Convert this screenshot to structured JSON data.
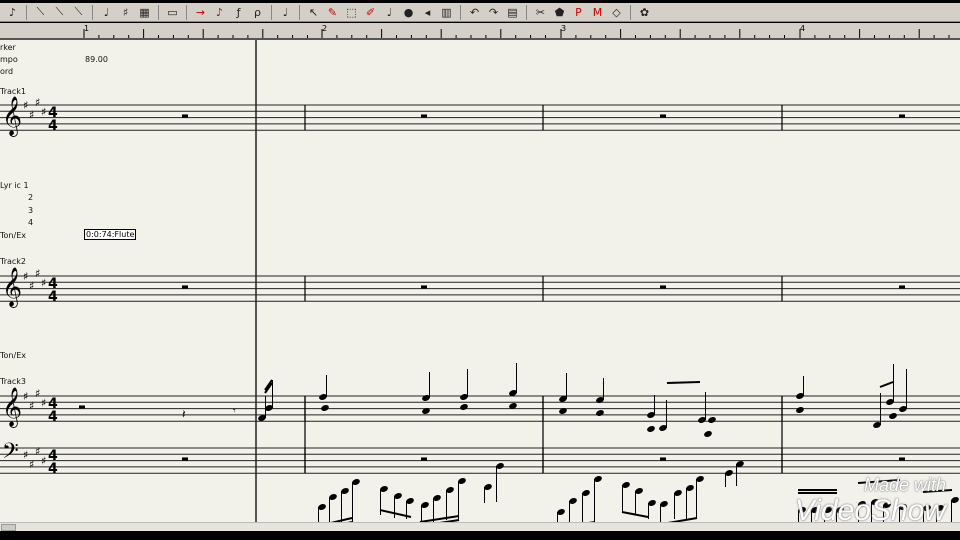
{
  "toolbar": {
    "icons": [
      "note-icon",
      "slur-icon",
      "slur-icon-2",
      "slur-icon-3",
      "quarter-notes-icon",
      "transpose-icon",
      "grid-icon",
      "keyboard-icon",
      "arrow-right-icon",
      "play-step-icon",
      "forte-icon",
      "piano-icon",
      "note-box-icon",
      "select-arrow-icon",
      "pencil-icon",
      "select-region-icon",
      "eraser-pen-icon",
      "note-select-icon",
      "color-select-icon",
      "volume-select-icon",
      "piano-select-icon",
      "undo-icon",
      "redo-icon",
      "save-icon",
      "cut-icon",
      "paste-icon",
      "page-down-icon",
      "measure-down-icon",
      "eraser-icon",
      "palette-icon"
    ]
  },
  "ruler": {
    "measures": [
      "1",
      "2",
      "3",
      "4"
    ]
  },
  "labels": {
    "marker": "rker",
    "tempo": "mpo",
    "tempo_value": "89.00",
    "chord": "ord",
    "track1": "Track1",
    "lyric": "Lyr ic  1",
    "lyric2": "2",
    "lyric3": "3",
    "lyric4": "4",
    "tonex1": "Ton/Ex",
    "tonex1_value": "0:0:74:Flute",
    "track2": "Track2",
    "tonex2": "Ton/Ex",
    "track3": "Track3"
  },
  "score": {
    "key": "E major (4 sharps)",
    "time_signature": "4/4",
    "time_top": "4",
    "time_bottom": "4"
  },
  "watermark": {
    "line1": "Made with",
    "line2": "VideoShow"
  }
}
